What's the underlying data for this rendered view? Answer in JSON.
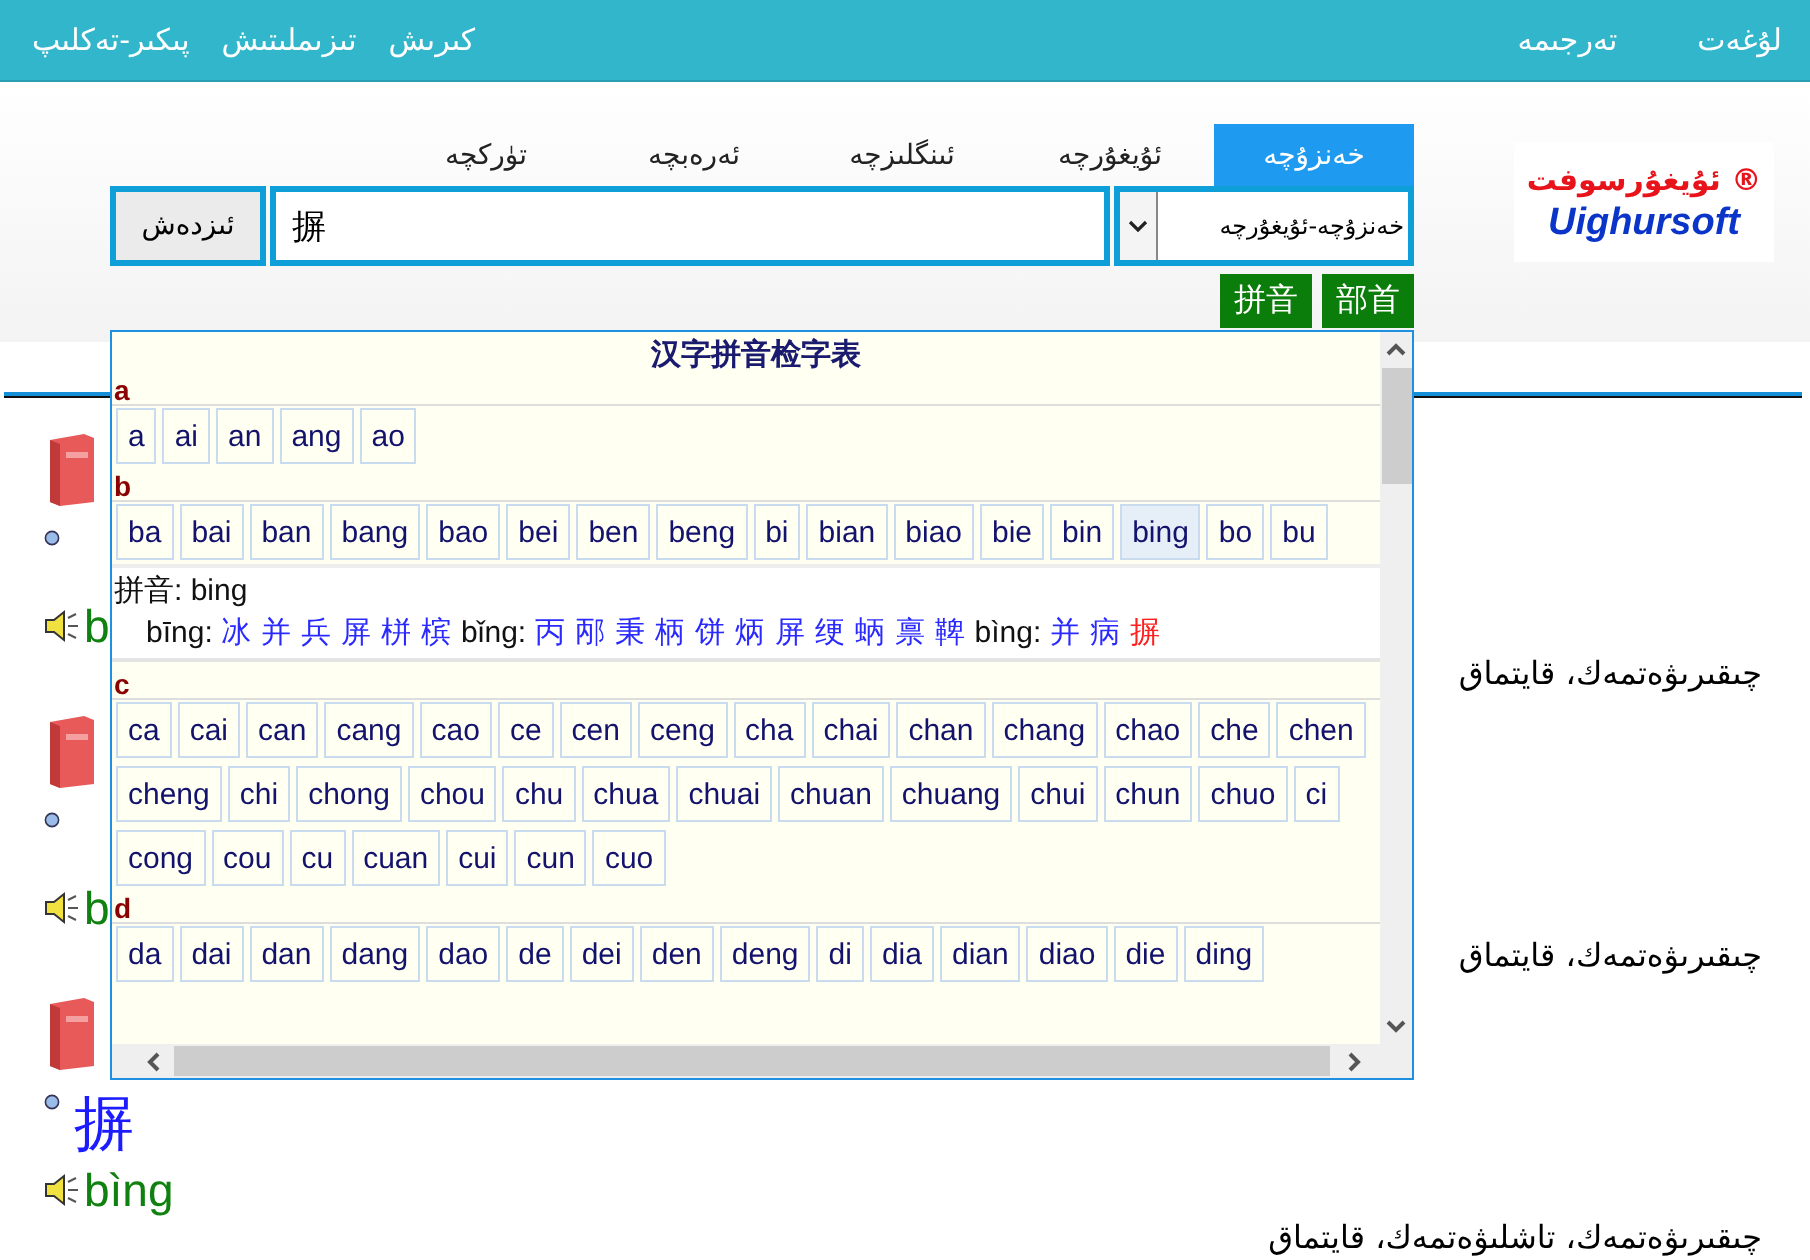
{
  "top_bar": {
    "left_links": [
      "كىرىش",
      "تىزىملىتىش",
      "پىكىر-تەكلىپ"
    ],
    "right_links": [
      "لۇغەت",
      "تەرجىمە"
    ]
  },
  "logo": {
    "text": "ئۇيغۇرسوفت",
    "mark": "®",
    "latin": "Uighursoft"
  },
  "tabs": [
    {
      "label": "خەنزۇچە",
      "selected": true
    },
    {
      "label": "ئۇيغۇرچە",
      "selected": false
    },
    {
      "label": "ئىنگلىزچە",
      "selected": false
    },
    {
      "label": "ئەرەبچە",
      "selected": false
    },
    {
      "label": "تۈركچە",
      "selected": false
    }
  ],
  "search": {
    "button": "ئىزدەش",
    "value": "摒",
    "dictionary": "خەنزۇچە-ئۇيغۇرچە"
  },
  "index_buttons": [
    "拼音",
    "部首"
  ],
  "popup": {
    "title": "汉字拼音检字表",
    "sections": [
      {
        "letter": "a",
        "syllables": [
          {
            "text": "a",
            "selected": false
          },
          {
            "text": "ai",
            "selected": false
          },
          {
            "text": "an",
            "selected": false
          },
          {
            "text": "ang",
            "selected": false
          },
          {
            "text": "ao",
            "selected": false
          }
        ]
      },
      {
        "letter": "b",
        "syllables": [
          {
            "text": "ba",
            "selected": false
          },
          {
            "text": "bai",
            "selected": false
          },
          {
            "text": "ban",
            "selected": false
          },
          {
            "text": "bang",
            "selected": false
          },
          {
            "text": "bao",
            "selected": false
          },
          {
            "text": "bei",
            "selected": false
          },
          {
            "text": "ben",
            "selected": false
          },
          {
            "text": "beng",
            "selected": false
          },
          {
            "text": "bi",
            "selected": false
          },
          {
            "text": "bian",
            "selected": false
          },
          {
            "text": "biao",
            "selected": false
          },
          {
            "text": "bie",
            "selected": false
          },
          {
            "text": "bin",
            "selected": false
          },
          {
            "text": "bing",
            "selected": true
          },
          {
            "text": "bo",
            "selected": false
          },
          {
            "text": "bu",
            "selected": false
          }
        ],
        "detail": {
          "label": "拼音: bing",
          "readings": [
            {
              "tone": "bīng:",
              "chars": [
                {
                  "text": "冰",
                  "selected": false
                },
                {
                  "text": "并",
                  "selected": false
                },
                {
                  "text": "兵",
                  "selected": false
                },
                {
                  "text": "屏",
                  "selected": false
                },
                {
                  "text": "栟",
                  "selected": false
                },
                {
                  "text": "槟",
                  "selected": false
                }
              ]
            },
            {
              "tone": "bǐng:",
              "chars": [
                {
                  "text": "丙",
                  "selected": false
                },
                {
                  "text": "邴",
                  "selected": false
                },
                {
                  "text": "秉",
                  "selected": false
                },
                {
                  "text": "柄",
                  "selected": false
                },
                {
                  "text": "饼",
                  "selected": false
                },
                {
                  "text": "炳",
                  "selected": false
                },
                {
                  "text": "屏",
                  "selected": false
                },
                {
                  "text": "绠",
                  "selected": false
                },
                {
                  "text": "蛃",
                  "selected": false
                },
                {
                  "text": "禀",
                  "selected": false
                },
                {
                  "text": "鞞",
                  "selected": false
                }
              ]
            },
            {
              "tone": "bìng:",
              "chars": [
                {
                  "text": "并",
                  "selected": false
                },
                {
                  "text": "病",
                  "selected": false
                },
                {
                  "text": "摒",
                  "selected": true
                }
              ]
            }
          ]
        }
      },
      {
        "letter": "c",
        "syllables": [
          {
            "text": "ca",
            "selected": false
          },
          {
            "text": "cai",
            "selected": false
          },
          {
            "text": "can",
            "selected": false
          },
          {
            "text": "cang",
            "selected": false
          },
          {
            "text": "cao",
            "selected": false
          },
          {
            "text": "ce",
            "selected": false
          },
          {
            "text": "cen",
            "selected": false
          },
          {
            "text": "ceng",
            "selected": false
          },
          {
            "text": "cha",
            "selected": false
          },
          {
            "text": "chai",
            "selected": false
          },
          {
            "text": "chan",
            "selected": false
          },
          {
            "text": "chang",
            "selected": false
          },
          {
            "text": "chao",
            "selected": false
          },
          {
            "text": "che",
            "selected": false
          },
          {
            "text": "chen",
            "selected": false
          },
          {
            "text": "cheng",
            "selected": false
          },
          {
            "text": "chi",
            "selected": false
          },
          {
            "text": "chong",
            "selected": false
          },
          {
            "text": "chou",
            "selected": false
          },
          {
            "text": "chu",
            "selected": false
          },
          {
            "text": "chua",
            "selected": false
          },
          {
            "text": "chuai",
            "selected": false
          },
          {
            "text": "chuan",
            "selected": false
          },
          {
            "text": "chuang",
            "selected": false
          },
          {
            "text": "chui",
            "selected": false
          },
          {
            "text": "chun",
            "selected": false
          },
          {
            "text": "chuo",
            "selected": false
          },
          {
            "text": "ci",
            "selected": false
          },
          {
            "text": "cong",
            "selected": false
          },
          {
            "text": "cou",
            "selected": false
          },
          {
            "text": "cu",
            "selected": false
          },
          {
            "text": "cuan",
            "selected": false
          },
          {
            "text": "cui",
            "selected": false
          },
          {
            "text": "cun",
            "selected": false
          },
          {
            "text": "cuo",
            "selected": false
          }
        ]
      },
      {
        "letter": "d",
        "syllables": [
          {
            "text": "da",
            "selected": false
          },
          {
            "text": "dai",
            "selected": false
          },
          {
            "text": "dan",
            "selected": false
          },
          {
            "text": "dang",
            "selected": false
          },
          {
            "text": "dao",
            "selected": false
          },
          {
            "text": "de",
            "selected": false
          },
          {
            "text": "dei",
            "selected": false
          },
          {
            "text": "den",
            "selected": false
          },
          {
            "text": "deng",
            "selected": false
          },
          {
            "text": "di",
            "selected": false
          },
          {
            "text": "dia",
            "selected": false
          },
          {
            "text": "dian",
            "selected": false
          },
          {
            "text": "diao",
            "selected": false
          },
          {
            "text": "die",
            "selected": false
          },
          {
            "text": "ding",
            "selected": false
          }
        ]
      }
    ]
  },
  "entries": [
    {
      "pinyin": "b",
      "meaning": "چىقىرىۋەتمەك، قايتماق"
    },
    {
      "pinyin": "b",
      "meaning": "چىقىرىۋەتمەك، قايتماق"
    },
    {
      "char": "摒",
      "pinyin": "bìng",
      "meaning": "چىقىرىۋەتمەك، تاشلىۋەتمەك، قايتماق"
    }
  ]
}
